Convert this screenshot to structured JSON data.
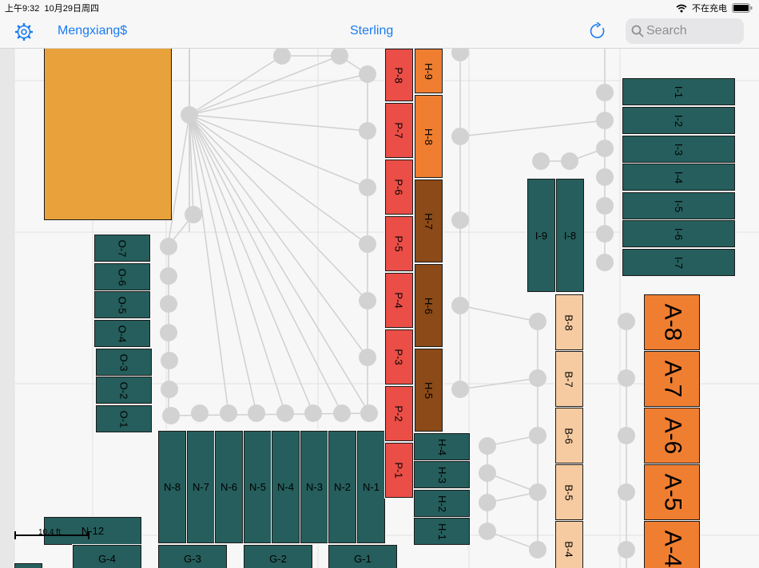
{
  "status_bar": {
    "time": "上午9:32",
    "date": "10月29日周四",
    "battery_text": "不在充电"
  },
  "nav": {
    "site_name": "Mengxiang$",
    "title": "Sterling",
    "search_placeholder": "Search"
  },
  "map": {
    "scale_label": "10.4 ft",
    "colors": {
      "teal": "#255e5c",
      "red": "#ea4e47",
      "orange": "#ef7e31",
      "brown": "#8b4a17",
      "peach": "#f6cba1",
      "gold": "#e9a23b"
    },
    "racks_o": [
      "O-7",
      "O-6",
      "O-5",
      "O-4",
      "O-3",
      "O-2",
      "O-1"
    ],
    "racks_n": [
      "N-8",
      "N-7",
      "N-6",
      "N-5",
      "N-4",
      "N-3",
      "N-2",
      "N-1"
    ],
    "rack_n12": "N-12",
    "racks_g": [
      "G-4",
      "G-3",
      "G-2",
      "G-1"
    ],
    "racks_p": [
      "P-8",
      "P-7",
      "P-6",
      "P-5",
      "P-4",
      "P-3",
      "P-2",
      "P-1"
    ],
    "racks_h_upper": [
      "H-9",
      "H-8",
      "H-7",
      "H-6",
      "H-5"
    ],
    "racks_h_lower": [
      "H-4",
      "H-3",
      "H-2",
      "H-1"
    ],
    "racks_i_side": [
      "I-9",
      "I-8"
    ],
    "racks_i": [
      "I-1",
      "I-2",
      "I-3",
      "I-4",
      "I-5",
      "I-6",
      "I-7"
    ],
    "racks_b": [
      "B-8",
      "B-7",
      "B-6",
      "B-5",
      "B-4"
    ],
    "racks_a": [
      "A-8",
      "A-7",
      "A-6",
      "A-5",
      "A-4"
    ]
  }
}
